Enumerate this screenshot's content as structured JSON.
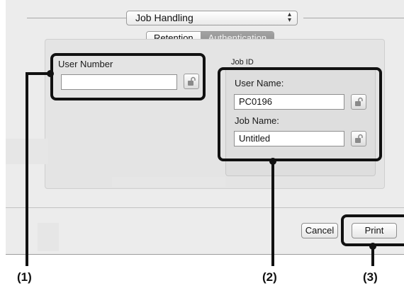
{
  "job_handling": {
    "popup_label": "Job Handling",
    "popup_arrows": "⌃⌄"
  },
  "tabs": [
    "Retention",
    "Authentication"
  ],
  "active_tab": "Authentication",
  "user_number": {
    "label": "User Number",
    "value": ""
  },
  "job_id": {
    "section_label": "Job ID",
    "user_name_label": "User Name:",
    "user_name_value": "PC0196",
    "job_name_label": "Job Name:",
    "job_name_value": "Untitled"
  },
  "buttons": {
    "cancel": "Cancel",
    "print": "Print"
  },
  "callouts": [
    "(1)",
    "(2)",
    "(3)"
  ],
  "icons": [
    "lock-icon"
  ]
}
